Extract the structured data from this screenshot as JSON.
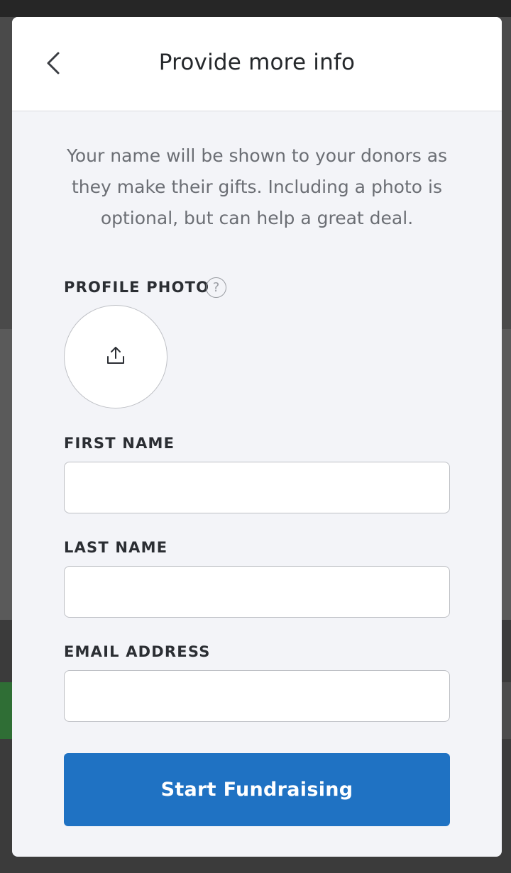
{
  "header": {
    "title": "Provide more info",
    "back_icon": "chevron-left-icon"
  },
  "intro": {
    "line1": "Your name will be shown to your donors as",
    "line2": "they make their gifts. Including a photo is",
    "line3": "optional, but can help a great deal."
  },
  "form": {
    "profile_photo_label": "PROFILE PHOTO",
    "help_glyph": "?",
    "upload_icon": "upload-icon",
    "first_name_label": "FIRST NAME",
    "first_name_value": "",
    "last_name_label": "LAST NAME",
    "last_name_value": "",
    "email_label": "EMAIL ADDRESS",
    "email_value": "",
    "submit_label": "Start Fundraising"
  },
  "colors": {
    "accent": "#1f72c3",
    "modal_bg": "#f3f4f8",
    "header_bg": "#ffffff",
    "title_text": "#25282b",
    "muted_text": "#6b6e74",
    "backdrop": "#3b3b3b"
  }
}
